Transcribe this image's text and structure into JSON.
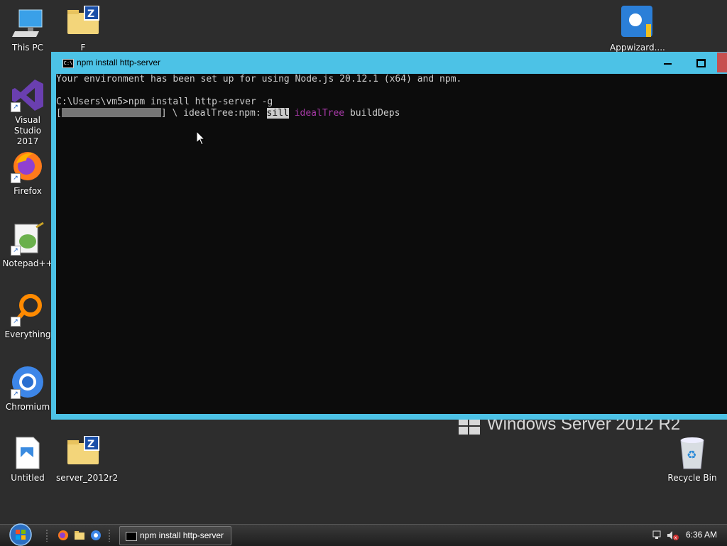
{
  "desktop": {
    "icons": [
      {
        "label": "This PC",
        "icon": "computer-icon"
      },
      {
        "label": "F",
        "icon": "zip-folder-icon"
      },
      {
        "label": "Appwizard....",
        "icon": "appwizard-icon"
      },
      {
        "label": "Visual Studio 2017",
        "icon": "visual-studio-icon"
      },
      {
        "label": "Firefox",
        "icon": "firefox-icon"
      },
      {
        "label": "Notepad++",
        "icon": "notepadpp-icon"
      },
      {
        "label": "Everything",
        "icon": "everything-search-icon"
      },
      {
        "label": "Chromium",
        "icon": "chromium-icon"
      },
      {
        "label": "Untitled",
        "icon": "image-file-icon"
      },
      {
        "label": "server_2012r2",
        "icon": "zip-folder-icon"
      },
      {
        "label": "Recycle Bin",
        "icon": "recycle-bin-icon"
      }
    ],
    "watermark": "Windows Server 2012 R2"
  },
  "console": {
    "title": "npm install http-server",
    "lines": {
      "env": "Your environment has been set up for using Node.js 20.12.1 (x64) and npm.",
      "prompt": "C:\\Users\\vm5>npm install http-server -g",
      "progress_prefix": "[",
      "progress_suffix": "] \\ idealTree:npm: ",
      "sill": "sill",
      "idealtree": "idealTree",
      "builddeps": " buildDeps"
    },
    "colors": {
      "background": "#0c0c0c",
      "text": "#cccccc",
      "magenta": "#a83aa8",
      "frame": "#4cc2e6"
    }
  },
  "taskbar": {
    "task_label": "npm install http-server",
    "clock": "6:36 AM"
  }
}
